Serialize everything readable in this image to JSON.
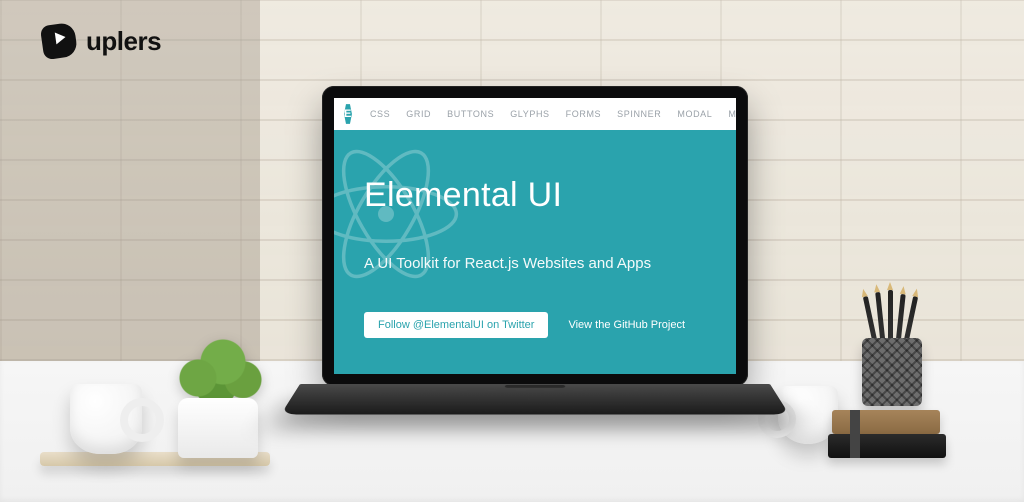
{
  "brand": {
    "name": "uplers"
  },
  "app": {
    "logo_letter": "E",
    "nav": [
      "CSS",
      "GRID",
      "BUTTONS",
      "GLYPHS",
      "FORMS",
      "SPINNER",
      "MODAL",
      "MISC"
    ],
    "hero": {
      "title": "Elemental UI",
      "subtitle": "A UI Toolkit for React.js Websites and Apps",
      "primary_cta": "Follow @ElementalUI on Twitter",
      "secondary_cta": "View the GitHub Project"
    },
    "colors": {
      "accent": "#2aa3ad"
    }
  }
}
